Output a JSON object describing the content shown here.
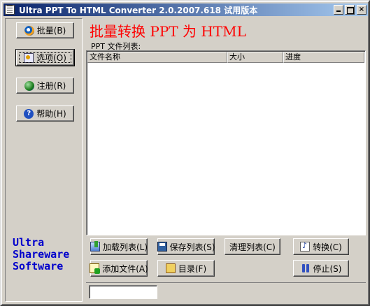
{
  "window": {
    "title": "Ultra PPT To HTML Converter 2.0.2007.618 试用版本",
    "caption_buttons": {
      "minimize_icon": "minimize-icon",
      "maximize_icon": "maximize-icon",
      "close_label": "×"
    }
  },
  "sidebar": {
    "items": [
      {
        "label": "批量(B)",
        "icon": "batch-icon"
      },
      {
        "label": "选项(O)",
        "icon": "options-icon"
      },
      {
        "label": "注册(R)",
        "icon": "register-icon"
      },
      {
        "label": "帮助(H)",
        "icon": "help-icon"
      }
    ],
    "brand_lines": [
      "Ultra",
      "Shareware",
      "Software"
    ]
  },
  "main": {
    "headline": "批量转换 PPT 为 HTML",
    "list_caption": "PPT 文件列表:",
    "columns": [
      "文件名称",
      "大小",
      "进度"
    ],
    "rows": []
  },
  "actions": {
    "load_list": "加载列表(L)",
    "save_list": "保存列表(S)",
    "clear_list": "清理列表(C)",
    "convert": "转换(C)",
    "add_file": "添加文件(A)",
    "directory": "目录(F)",
    "stop": "停止(S)"
  },
  "status": {
    "text": ""
  },
  "colors": {
    "headline": "#ff0000",
    "brand": "#0000cc",
    "titlebar_start": "#0a246a",
    "titlebar_end": "#a6caf0"
  }
}
